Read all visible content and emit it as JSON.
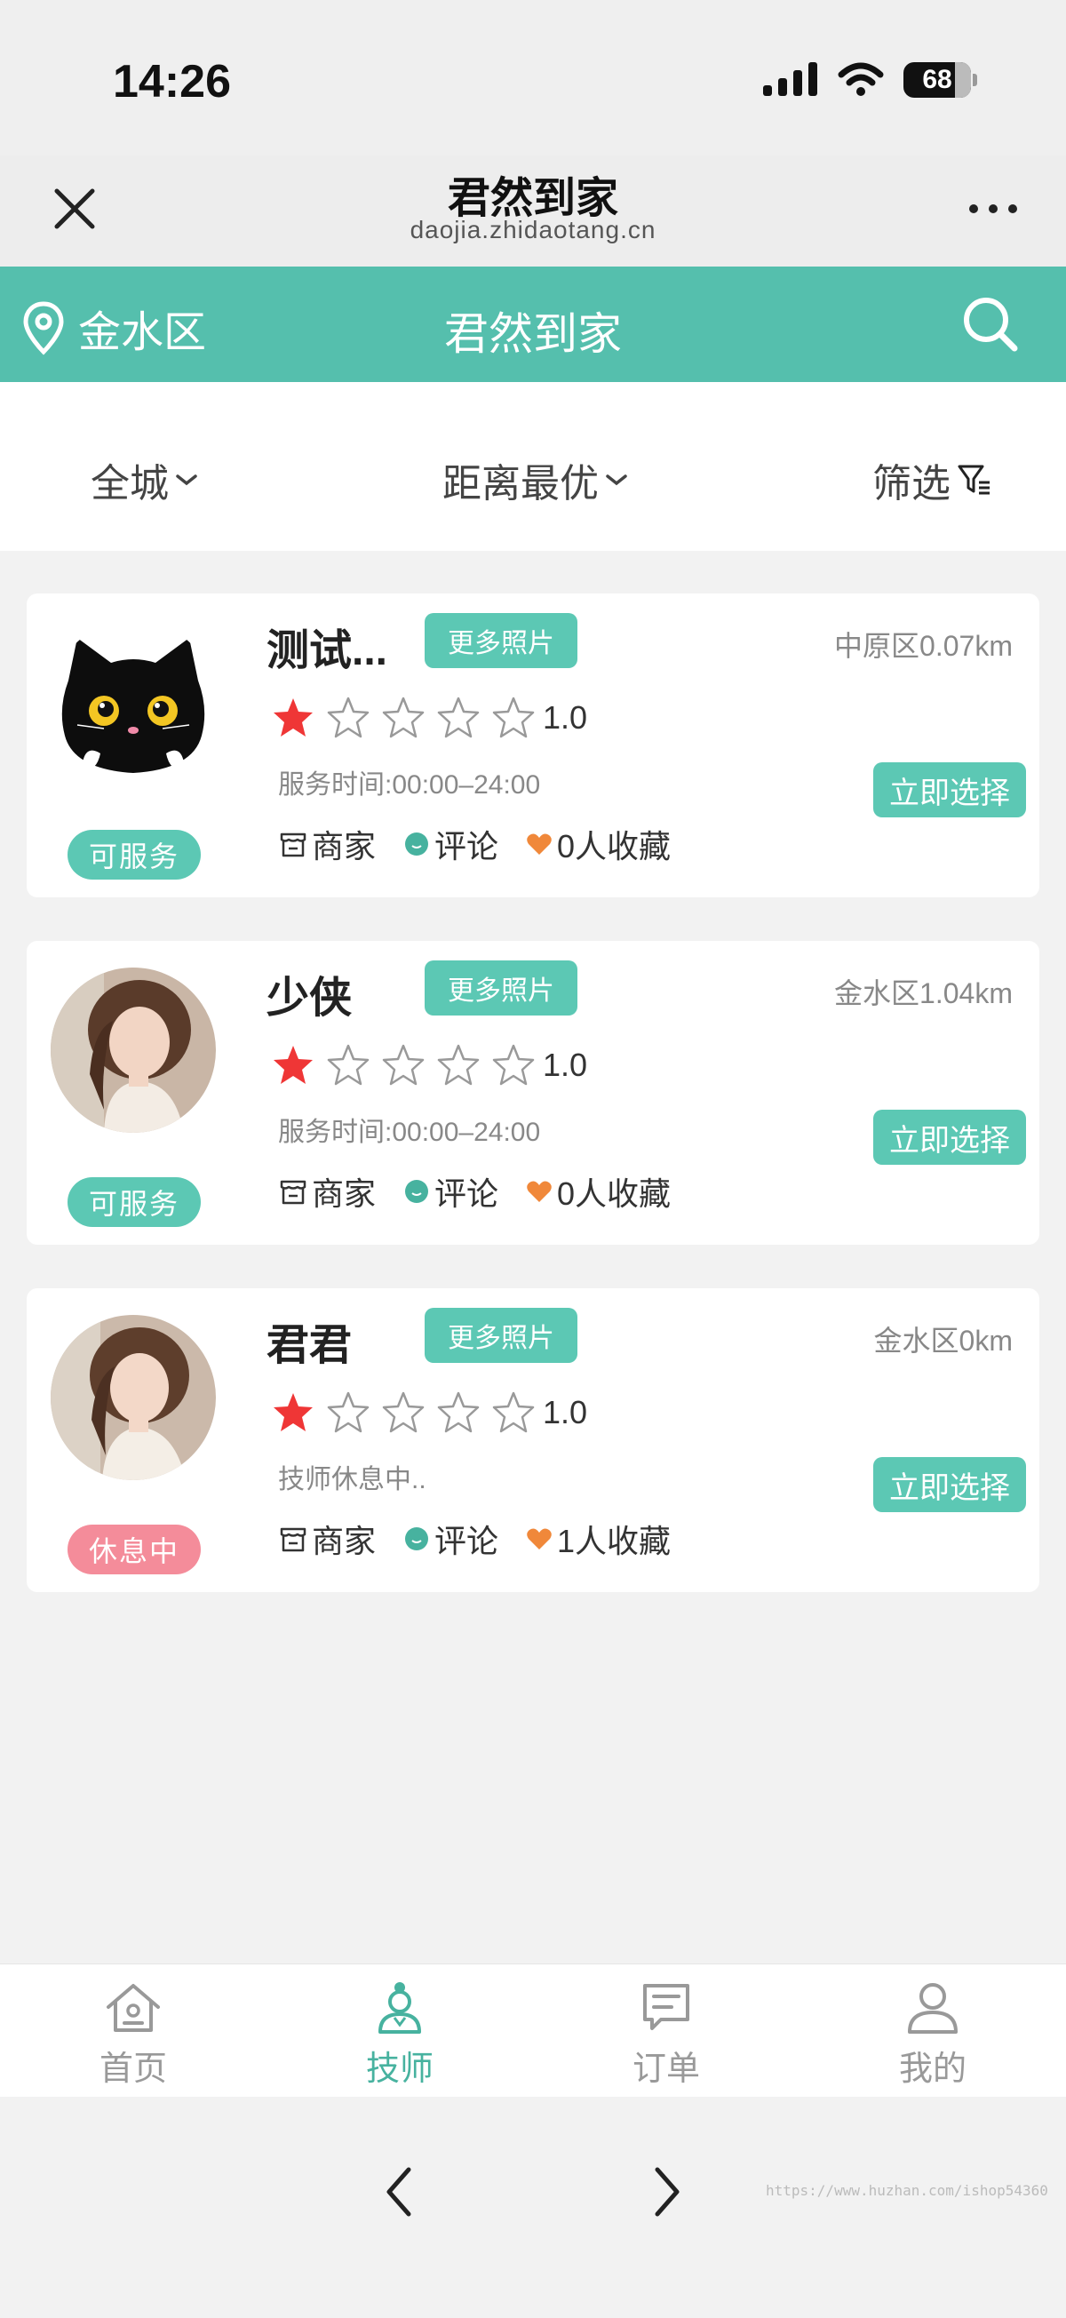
{
  "status_bar": {
    "time": "14:26",
    "battery": "68"
  },
  "webview_nav": {
    "title": "君然到家",
    "subtitle": "daojia.zhidaotang.cn"
  },
  "header": {
    "location": "金水区",
    "title": "君然到家"
  },
  "filters": {
    "city": "全城",
    "sort": "距离最优",
    "filter": "筛选"
  },
  "technicians": [
    {
      "name": "测试...",
      "more_photos": "更多照片",
      "distance": "中原区0.07km",
      "rating": "1.0",
      "stars_filled": 1,
      "stars_total": 5,
      "service_time": "服务时间:00:00–24:00",
      "select": "立即选择",
      "status": "可服务",
      "shop": "商家",
      "comment": "评论",
      "favorites": "0人收藏"
    },
    {
      "name": "少侠",
      "more_photos": "更多照片",
      "distance": "金水区1.04km",
      "rating": "1.0",
      "stars_filled": 1,
      "stars_total": 5,
      "service_time": "服务时间:00:00–24:00",
      "select": "立即选择",
      "status": "可服务",
      "shop": "商家",
      "comment": "评论",
      "favorites": "0人收藏"
    },
    {
      "name": "君君",
      "more_photos": "更多照片",
      "distance": "金水区0km",
      "rating": "1.0",
      "stars_filled": 1,
      "stars_total": 5,
      "service_time": "技师休息中..",
      "select": "立即选择",
      "status": "休息中",
      "shop": "商家",
      "comment": "评论",
      "favorites": "1人收藏"
    }
  ],
  "tabs": [
    {
      "label": "首页",
      "icon": "home-icon",
      "active": false
    },
    {
      "label": "技师",
      "icon": "technician-icon",
      "active": true
    },
    {
      "label": "订单",
      "icon": "order-icon",
      "active": false
    },
    {
      "label": "我的",
      "icon": "profile-icon",
      "active": false
    }
  ],
  "watermark": "https://www.huzhan.com/ishop54360",
  "colors": {
    "accent": "#55bfad",
    "available": "#5cc8b4",
    "resting": "#f48c9a",
    "star": "#ef3636"
  }
}
